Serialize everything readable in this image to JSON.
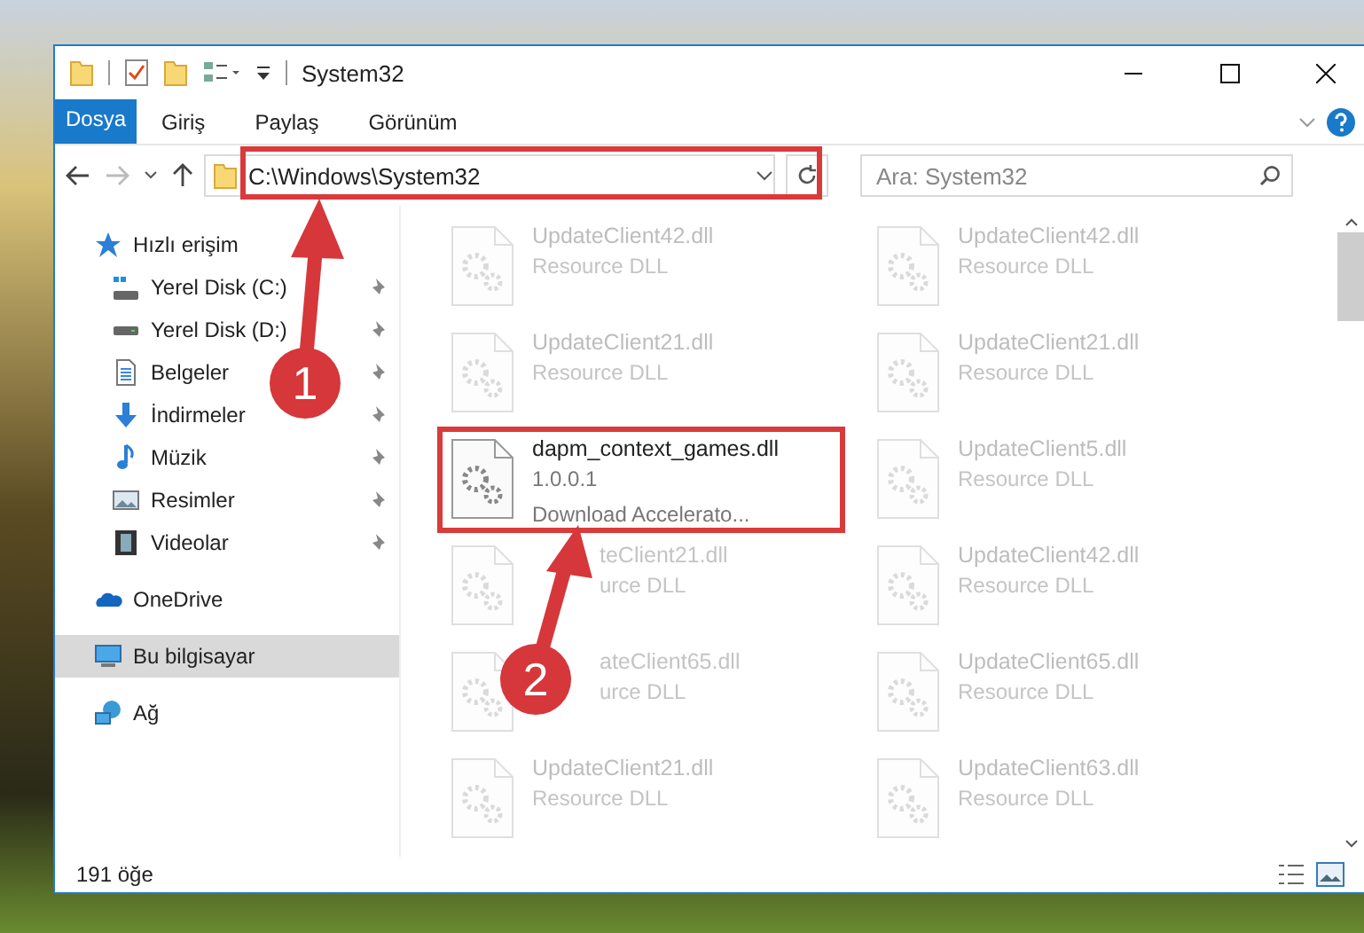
{
  "window": {
    "title": "System32"
  },
  "ribbon_tabs": [
    {
      "label": "Dosya",
      "kind": "file"
    },
    {
      "label": "Giriş",
      "kind": "tab"
    },
    {
      "label": "Paylaş",
      "kind": "tab"
    },
    {
      "label": "Görünüm",
      "kind": "tab"
    }
  ],
  "address_bar": {
    "value": "C:\\Windows\\System32",
    "highlighted": true
  },
  "search": {
    "placeholder": "Ara: System32"
  },
  "sidebar": {
    "items": [
      {
        "label": "Hızlı erişim",
        "kind": "star",
        "selected": false,
        "children": [
          {
            "label": "Yerel Disk (C:)",
            "kind": "drive-c",
            "pinned": true,
            "selected": false
          },
          {
            "label": "Yerel Disk (D:)",
            "kind": "drive",
            "pinned": true,
            "selected": false
          },
          {
            "label": "Belgeler",
            "kind": "document",
            "pinned": true,
            "selected": false
          },
          {
            "label": "İndirmeler",
            "kind": "download",
            "pinned": true,
            "selected": false
          },
          {
            "label": "Müzik",
            "kind": "music",
            "pinned": true,
            "selected": false
          },
          {
            "label": "Resimler",
            "kind": "pictures",
            "pinned": true,
            "selected": false
          },
          {
            "label": "Videolar",
            "kind": "video",
            "pinned": true,
            "selected": false
          }
        ]
      },
      {
        "label": "OneDrive",
        "kind": "cloud",
        "selected": false
      },
      {
        "label": "Bu bilgisayar",
        "kind": "computer",
        "selected": true
      },
      {
        "label": "Ağ",
        "kind": "network",
        "selected": false
      }
    ]
  },
  "files": [
    {
      "name": "UpdateClient42.dll",
      "details": [
        "Resource DLL"
      ],
      "kind": "dimmed"
    },
    {
      "name": "UpdateClient42.dll",
      "details": [
        "Resource DLL"
      ],
      "kind": "dimmed"
    },
    {
      "name": "UpdateClient21.dll",
      "details": [
        "Resource DLL"
      ],
      "kind": "dimmed"
    },
    {
      "name": "UpdateClient21.dll",
      "details": [
        "Resource DLL"
      ],
      "kind": "dimmed"
    },
    {
      "name": "dapm_context_games.dll",
      "details": [
        "1.0.0.1",
        "Download Accelerato..."
      ],
      "kind": "focused"
    },
    {
      "name": "UpdateClient5.dll",
      "details": [
        "Resource DLL"
      ],
      "kind": "dimmed"
    },
    {
      "name": "teClient21.dll",
      "details": [
        "urce DLL"
      ],
      "kind": "covered"
    },
    {
      "name": "UpdateClient42.dll",
      "details": [
        "Resource DLL"
      ],
      "kind": "dimmed"
    },
    {
      "name": "ateClient65.dll",
      "details": [
        "urce DLL"
      ],
      "kind": "covered"
    },
    {
      "name": "UpdateClient65.dll",
      "details": [
        "Resource DLL"
      ],
      "kind": "dimmed"
    },
    {
      "name": "UpdateClient21.dll",
      "details": [
        "Resource DLL"
      ],
      "kind": "dimmed"
    },
    {
      "name": "UpdateClient63.dll",
      "details": [
        "Resource DLL"
      ],
      "kind": "dimmed"
    }
  ],
  "status_bar": {
    "count": "191 öğe"
  },
  "annotations": [
    {
      "number": "1"
    },
    {
      "number": "2"
    }
  ]
}
